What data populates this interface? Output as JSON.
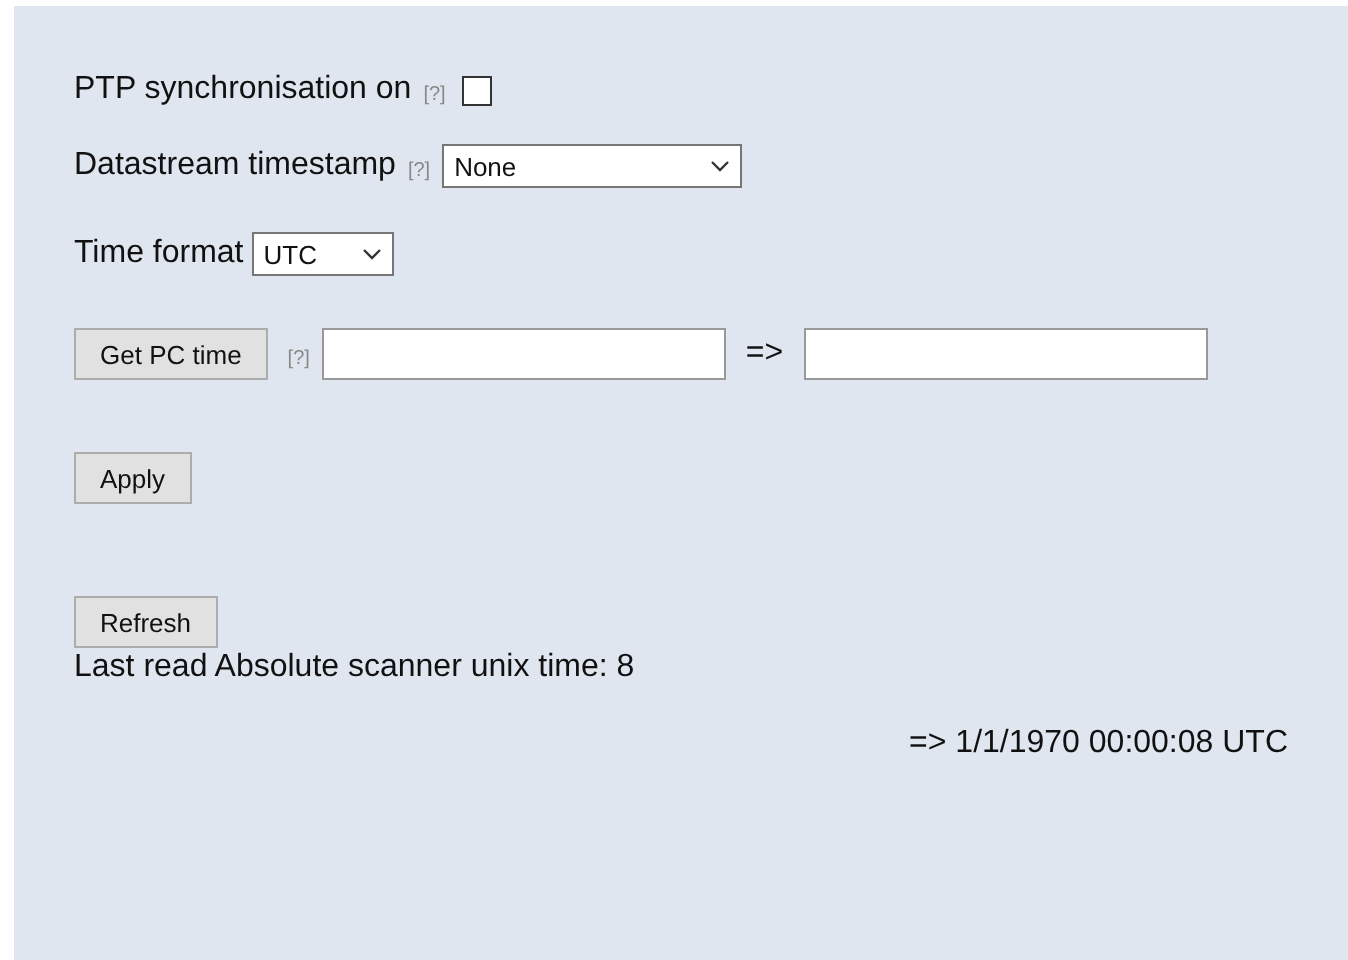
{
  "ptp": {
    "label": "PTP synchronisation on",
    "help": "[?]",
    "checked": false
  },
  "datastream": {
    "label": "Datastream timestamp",
    "help": "[?]",
    "value": "None"
  },
  "time_format": {
    "label": "Time format",
    "value": "UTC"
  },
  "pc_time": {
    "button": "Get PC time",
    "help": "[?]",
    "arrow": "=>"
  },
  "apply": "Apply",
  "refresh": "Refresh",
  "last_read": "Last read Absolute scanner unix time: 8",
  "converted": "=> 1/1/1970 00:00:08 UTC"
}
